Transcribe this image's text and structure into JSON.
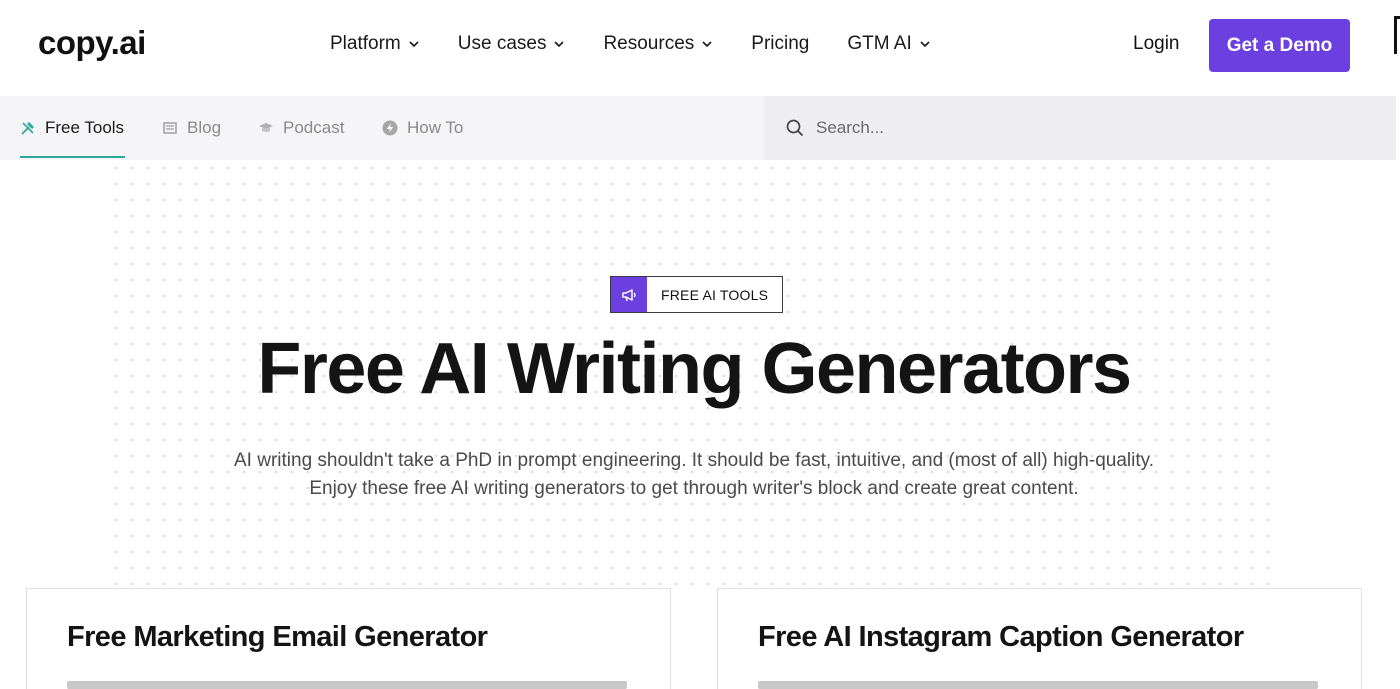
{
  "brand": {
    "logo": "copy.ai",
    "accent": "#6b3fe0",
    "tab_underline": "#2aa99a"
  },
  "nav": {
    "items": [
      {
        "label": "Platform",
        "has_dropdown": true
      },
      {
        "label": "Use cases",
        "has_dropdown": true
      },
      {
        "label": "Resources",
        "has_dropdown": true
      },
      {
        "label": "Pricing",
        "has_dropdown": false
      },
      {
        "label": "GTM AI",
        "has_dropdown": true
      }
    ],
    "login": "Login",
    "cta": "Get a Demo"
  },
  "subnav": {
    "tabs": [
      {
        "label": "Free Tools",
        "icon": "tools-icon",
        "active": true
      },
      {
        "label": "Blog",
        "icon": "newspaper-icon",
        "active": false
      },
      {
        "label": "Podcast",
        "icon": "graduation-cap-icon",
        "active": false
      },
      {
        "label": "How To",
        "icon": "lightning-icon",
        "active": false
      }
    ],
    "search": {
      "placeholder": "Search...",
      "icon": "search-icon"
    }
  },
  "hero": {
    "badge": {
      "label": "FREE AI TOOLS",
      "icon": "megaphone-icon"
    },
    "title": "Free AI Writing Generators",
    "subtitle_line1": "AI writing shouldn't take a PhD in prompt engineering. It should be fast, intuitive, and (most of all) high-quality.",
    "subtitle_line2": "Enjoy these free AI writing generators to get through writer's block and create great content."
  },
  "cards": [
    {
      "title": "Free Marketing Email Generator"
    },
    {
      "title": "Free AI Instagram Caption Generator"
    }
  ]
}
